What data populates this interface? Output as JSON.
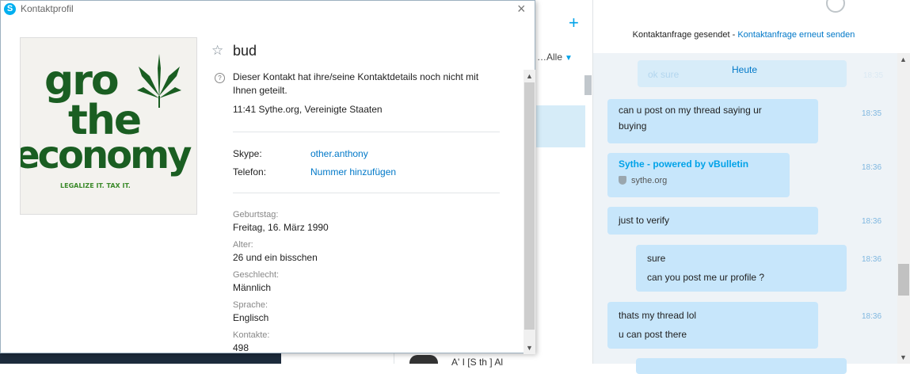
{
  "dialog": {
    "title": "Kontaktprofil",
    "close_glyph": "×",
    "contact_name": "bud",
    "notice": "Dieser Kontakt hat ihre/seine Kontaktdetails noch nicht mit Ihnen geteilt.",
    "local_time": "11:41 Sythe.org, Vereinigte Staaten",
    "photo_text": {
      "line1": "gro",
      "line2": "the",
      "line3": "economy",
      "line4": "LEGALIZE IT. TAX IT."
    },
    "skype_label": "Skype:",
    "skype_value": "other.anthony",
    "phone_label": "Telefon:",
    "phone_value": "Nummer hinzufügen",
    "fields": [
      {
        "label": "Geburtstag:",
        "value": "Freitag, 16. März 1990"
      },
      {
        "label": "Alter:",
        "value": "26 und ein bisschen"
      },
      {
        "label": "Geschlecht:",
        "value": "Männlich"
      },
      {
        "label": "Sprache:",
        "value": "Englisch"
      },
      {
        "label": "Kontakte:",
        "value": "498"
      }
    ]
  },
  "contacts_panel": {
    "add_glyph": "+",
    "filter_label": "Alle",
    "visible_name": "A' I  [S  th ] Al"
  },
  "chat": {
    "header_text": "Kontaktanfrage gesendet - ",
    "header_link": "Kontaktanfrage erneut senden",
    "faded_message": "ok sure",
    "faded_time": "18:35",
    "day_separator": "Heute",
    "messages": [
      {
        "lines": [
          "can u post on my thread saying ur",
          "buying"
        ],
        "time": "18:35"
      },
      {
        "title": "Sythe - powered by vBulletin",
        "site": "sythe.org",
        "time": "18:36"
      },
      {
        "lines": [
          "just to verify"
        ],
        "time": "18:36"
      },
      {
        "lines": [
          "sure",
          "can you post me ur profile ?"
        ],
        "time": "18:36"
      },
      {
        "lines": [
          "thats my thread lol",
          "u can post there"
        ],
        "time": "18:36"
      }
    ]
  },
  "colors": {
    "accent": "#00a2e8",
    "link": "#0078c8",
    "bubble": "#c7e6fb",
    "chat_bg": "#eef3f7"
  }
}
